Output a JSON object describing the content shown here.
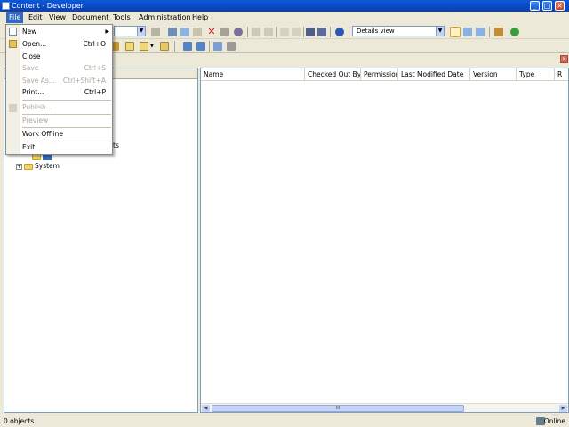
{
  "window": {
    "title": "Content - Developer",
    "minimize": "_",
    "maximize": "□",
    "close": "×"
  },
  "menubar": {
    "items": [
      "File",
      "Edit",
      "View",
      "Document",
      "Tools",
      "Administration",
      "Help"
    ],
    "active": "File"
  },
  "toolbar": {
    "view_selector": "Details view",
    "view_selector_arrow": "▼"
  },
  "file_menu": {
    "new": "New",
    "new_submenu_arrow": "▶",
    "open": "Open...",
    "open_shortcut": "Ctrl+O",
    "close": "Close",
    "save": "Save",
    "save_shortcut": "Ctrl+S",
    "save_as": "Save As...",
    "save_as_shortcut": "Ctrl+Shift+A",
    "print": "Print...",
    "print_shortcut": "Ctrl+P",
    "publish": "Publish...",
    "preview": "Preview",
    "work_offline": "Work Offline",
    "exit": "Exit"
  },
  "tree": {
    "partial_item_suffix": "ts",
    "system": "System",
    "expander_plus": "+"
  },
  "list": {
    "columns": [
      "Name",
      "Checked Out By",
      "Permission",
      "Last Modified Date",
      "Version",
      "Type",
      "R"
    ],
    "scroll_grip": "III",
    "scroll_left": "◀",
    "scroll_right": "▶"
  },
  "statusbar": {
    "object_count": "0 objects",
    "connection": "Online"
  },
  "colors": {
    "titlebar": "#0a49c8",
    "menu_highlight": "#316ac5",
    "pane_border": "#7f9db9",
    "chrome": "#ece9d8"
  }
}
